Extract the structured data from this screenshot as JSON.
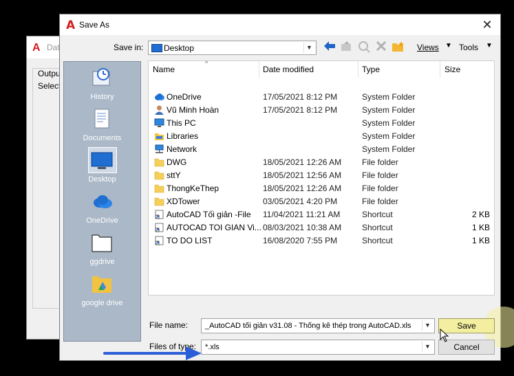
{
  "background_dialog": {
    "title": "Dat",
    "lines": [
      "Output",
      "Select"
    ]
  },
  "dialog": {
    "title": "Save As",
    "close_glyph": "✕",
    "save_in_label": "Save in:",
    "save_in_value": "Desktop",
    "toolbar": {
      "views_label": "Views",
      "tools_label": "Tools"
    }
  },
  "places": [
    {
      "label": "History",
      "icon": "history-icon"
    },
    {
      "label": "Documents",
      "icon": "documents-icon"
    },
    {
      "label": "Desktop",
      "icon": "desktop-icon"
    },
    {
      "label": "OneDrive",
      "icon": "onedrive-icon"
    },
    {
      "label": "ggdrive",
      "icon": "folder-icon"
    },
    {
      "label": "google drive",
      "icon": "google-drive-icon"
    }
  ],
  "columns": {
    "name": "Name",
    "date": "Date modified",
    "type": "Type",
    "size": "Size"
  },
  "files": [
    {
      "name": "OneDrive",
      "date": "17/05/2021 8:12 PM",
      "type": "System Folder",
      "size": "",
      "icon": "onedrive-icon"
    },
    {
      "name": "Vũ Minh Hoàn",
      "date": "17/05/2021 8:12 PM",
      "type": "System Folder",
      "size": "",
      "icon": "user-icon"
    },
    {
      "name": "This PC",
      "date": "",
      "type": "System Folder",
      "size": "",
      "icon": "computer-icon"
    },
    {
      "name": "Libraries",
      "date": "",
      "type": "System Folder",
      "size": "",
      "icon": "libraries-icon"
    },
    {
      "name": "Network",
      "date": "",
      "type": "System Folder",
      "size": "",
      "icon": "network-icon"
    },
    {
      "name": "DWG",
      "date": "18/05/2021 12:26 AM",
      "type": "File folder",
      "size": "",
      "icon": "folder-icon"
    },
    {
      "name": "sttY",
      "date": "18/05/2021 12:56 AM",
      "type": "File folder",
      "size": "",
      "icon": "folder-icon"
    },
    {
      "name": "ThongKeThep",
      "date": "18/05/2021 12:26 AM",
      "type": "File folder",
      "size": "",
      "icon": "folder-icon"
    },
    {
      "name": "XDTower",
      "date": "03/05/2021 4:20 PM",
      "type": "File folder",
      "size": "",
      "icon": "folder-icon"
    },
    {
      "name": "AutoCAD Tối giản -File",
      "date": "11/04/2021 11:21 AM",
      "type": "Shortcut",
      "size": "2 KB",
      "icon": "shortcut-icon"
    },
    {
      "name": "AUTOCAD TOI GIAN Vi...",
      "date": "08/03/2021 10:38 AM",
      "type": "Shortcut",
      "size": "1 KB",
      "icon": "shortcut-icon"
    },
    {
      "name": "TO DO LIST",
      "date": "16/08/2020 7:55 PM",
      "type": "Shortcut",
      "size": "1 KB",
      "icon": "shortcut-icon"
    }
  ],
  "bottom": {
    "file_name_label": "File name:",
    "file_name_value": "_AutoCAD tối giản v31.08 - Thống kê thép trong AutoCAD.xls",
    "file_type_label": "Files of type:",
    "file_type_value": "*.xls",
    "save_label": "Save",
    "cancel_label": "Cancel"
  },
  "colors": {
    "places_bg": "#aab8c8",
    "autocad_red": "#d42020",
    "annotation_arrow": "#2a5ed8"
  }
}
